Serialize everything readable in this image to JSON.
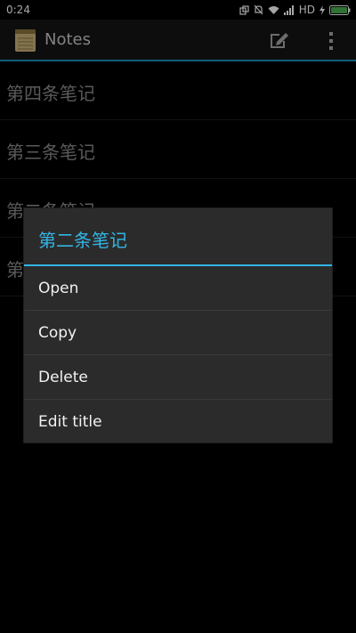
{
  "status_bar": {
    "time": "0:24",
    "network": "HD",
    "battery_color": "#4caf50"
  },
  "action_bar": {
    "title": "Notes",
    "accent_color": "#1c8fb3",
    "icons": [
      "notes-app-icon",
      "compose-icon",
      "overflow-menu-icon"
    ]
  },
  "notes": [
    {
      "label": "第四条笔记"
    },
    {
      "label": "第三条笔记"
    },
    {
      "label": "第二条笔记"
    },
    {
      "label": "第一条笔记"
    }
  ],
  "dialog": {
    "title": "第二条笔记",
    "title_color": "#33b5e5",
    "items": [
      {
        "label": "Open"
      },
      {
        "label": "Copy"
      },
      {
        "label": "Delete"
      },
      {
        "label": "Edit title"
      }
    ]
  }
}
